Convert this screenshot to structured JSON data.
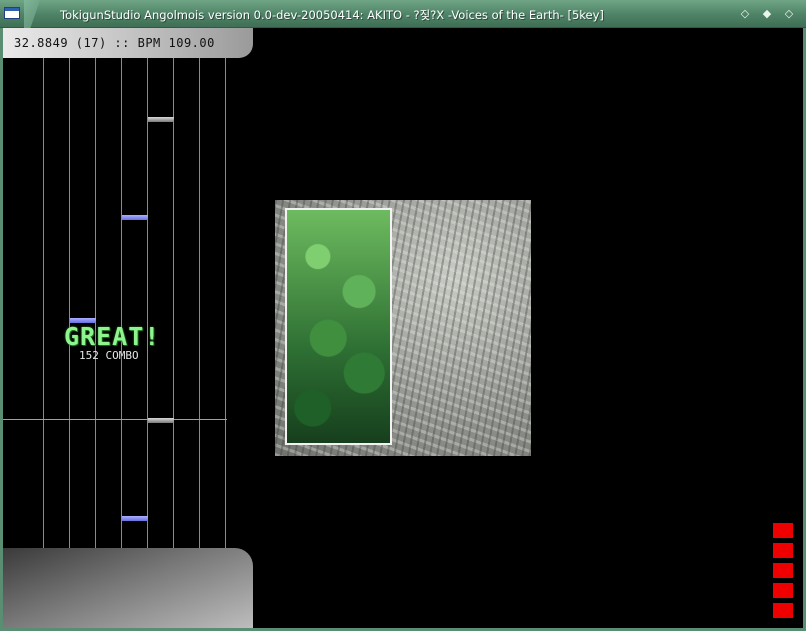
{
  "window": {
    "title": "TokigunStudio Angolmois version 0.0-dev-20050414: AKITO - ?짖?X -Voices of the Earth- [5key]",
    "buttons": [
      {
        "name": "minimize",
        "glyph": "◇"
      },
      {
        "name": "maximize",
        "glyph": "◆"
      },
      {
        "name": "close",
        "glyph": "◇"
      }
    ]
  },
  "hud": {
    "status": "32.8849 (17) :: BPM 109.00"
  },
  "judgement": {
    "grade": "GREAT!",
    "combo": "152 COMBO"
  },
  "notes": [
    {
      "lane": 4,
      "type": "gray",
      "position": 0.12
    },
    {
      "lane": 3,
      "type": "blue",
      "position": 0.32
    },
    {
      "lane": 1,
      "type": "blue",
      "position": 0.53
    },
    {
      "lane": 4,
      "type": "gray",
      "position": 0.735
    },
    {
      "lane": 3,
      "type": "blue",
      "position": 0.935
    }
  ],
  "gauge": {
    "segments_lit": 5
  },
  "colors": {
    "judgement": "#8ef58e",
    "note_blue": "#8088f0",
    "note_gray": "#b0b0b0",
    "gauge": "#ee0000",
    "titlebar": "#4e8266"
  }
}
